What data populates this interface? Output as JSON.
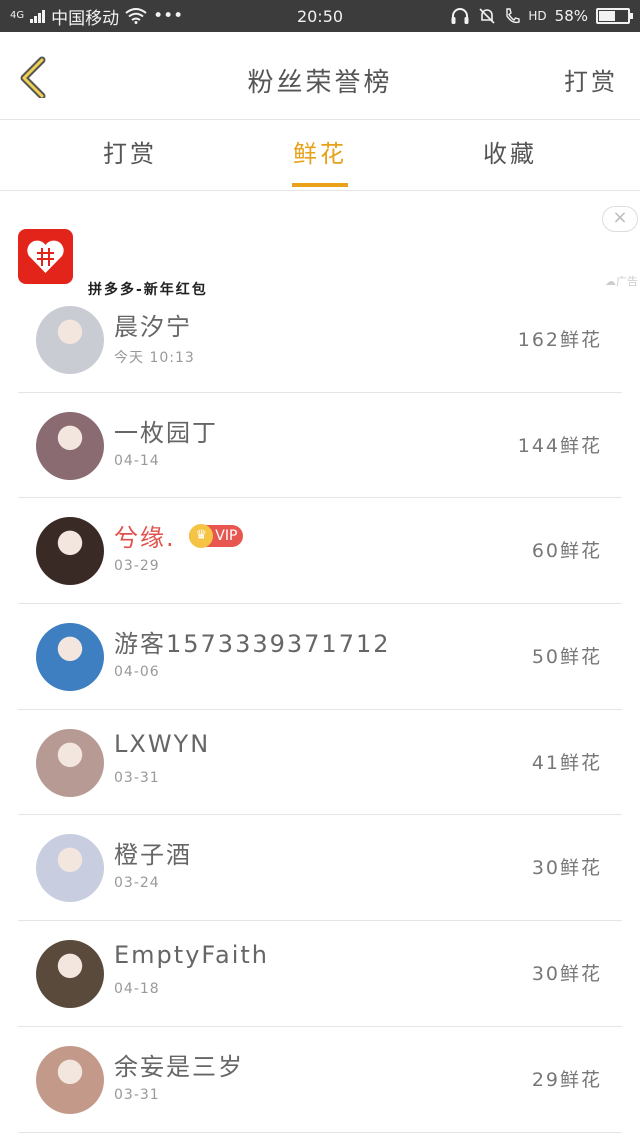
{
  "status_bar": {
    "network": "4G",
    "carrier": "中国移动",
    "more": "•••",
    "time": "20:50",
    "hd": "HD",
    "battery_text": "58%",
    "battery_level": 0.58
  },
  "header": {
    "title": "粉丝荣誉榜",
    "action": "打赏"
  },
  "tabs": [
    {
      "label": "打赏",
      "active": false
    },
    {
      "label": "鲜花",
      "active": true
    },
    {
      "label": "收藏",
      "active": false
    }
  ],
  "ad": {
    "text": "拼多多-新年红包",
    "close": "×",
    "label": "广告"
  },
  "list": [
    {
      "name": "晨汐宁",
      "date": "今天 10:13",
      "count": "162鲜花",
      "vip": false,
      "avatar_color": "#c9ccd2"
    },
    {
      "name": "一枚园丁",
      "date": "04-14",
      "count": "144鲜花",
      "vip": false,
      "avatar_color": "#8a6b72"
    },
    {
      "name": "兮缘.",
      "date": "03-29",
      "count": "60鲜花",
      "vip": true,
      "vip_label": "VIP",
      "avatar_color": "#3a2a26"
    },
    {
      "name": "游客1573339371712",
      "date": "04-06",
      "count": "50鲜花",
      "vip": false,
      "avatar_color": "#3d7fc0"
    },
    {
      "name": "LXWYN",
      "date": "03-31",
      "count": "41鲜花",
      "vip": false,
      "avatar_color": "#b89a95"
    },
    {
      "name": "橙子酒",
      "date": "03-24",
      "count": "30鲜花",
      "vip": false,
      "avatar_color": "#c8cde0"
    },
    {
      "name": "EmptyFaith",
      "date": "04-18",
      "count": "30鲜花",
      "vip": false,
      "avatar_color": "#5a4a3c"
    },
    {
      "name": "余妄是三岁",
      "date": "03-31",
      "count": "29鲜花",
      "vip": false,
      "avatar_color": "#c39a8a"
    }
  ]
}
